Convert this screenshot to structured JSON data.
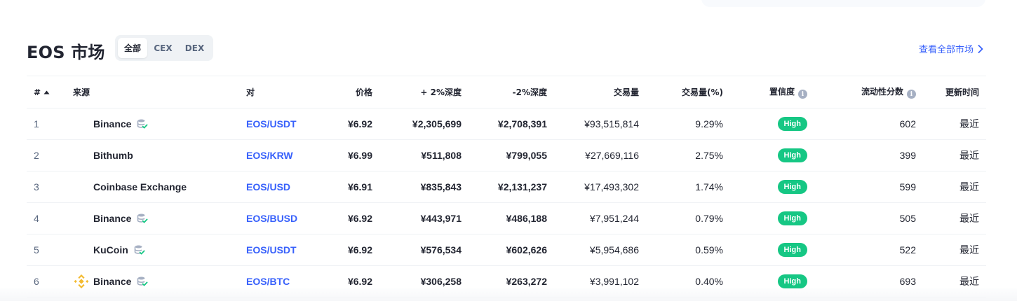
{
  "title": "EOS 市场",
  "filters": [
    "全部",
    "CEX",
    "DEX"
  ],
  "active_filter": "全部",
  "view_all": "查看全部市场",
  "columns": {
    "rank": "#",
    "source": "来源",
    "pair": "对",
    "price": "价格",
    "depth_plus": "+ 2%深度",
    "depth_minus": "-2%深度",
    "volume": "交易量",
    "volume_pct": "交易量(%)",
    "confidence": "置信度",
    "liquidity": "流动性分数",
    "updated": "更新时间"
  },
  "rows": [
    {
      "rank": "1",
      "source": "Binance",
      "verified_icon": true,
      "logo": "",
      "pair": "EOS/USDT",
      "price": "¥6.92",
      "depth_plus": "¥2,305,699",
      "depth_minus": "¥2,708,391",
      "volume": "¥93,515,814",
      "volume_pct": "9.29%",
      "confidence": "High",
      "liquidity": "602",
      "updated": "最近"
    },
    {
      "rank": "2",
      "source": "Bithumb",
      "verified_icon": false,
      "logo": "",
      "pair": "EOS/KRW",
      "price": "¥6.99",
      "depth_plus": "¥511,808",
      "depth_minus": "¥799,055",
      "volume": "¥27,669,116",
      "volume_pct": "2.75%",
      "confidence": "High",
      "liquidity": "399",
      "updated": "最近"
    },
    {
      "rank": "3",
      "source": "Coinbase Exchange",
      "verified_icon": false,
      "logo": "",
      "pair": "EOS/USD",
      "price": "¥6.91",
      "depth_plus": "¥835,843",
      "depth_minus": "¥2,131,237",
      "volume": "¥17,493,302",
      "volume_pct": "1.74%",
      "confidence": "High",
      "liquidity": "599",
      "updated": "最近"
    },
    {
      "rank": "4",
      "source": "Binance",
      "verified_icon": true,
      "logo": "",
      "pair": "EOS/BUSD",
      "price": "¥6.92",
      "depth_plus": "¥443,971",
      "depth_minus": "¥486,188",
      "volume": "¥7,951,244",
      "volume_pct": "0.79%",
      "confidence": "High",
      "liquidity": "505",
      "updated": "最近"
    },
    {
      "rank": "5",
      "source": "KuCoin",
      "verified_icon": true,
      "logo": "",
      "pair": "EOS/USDT",
      "price": "¥6.92",
      "depth_plus": "¥576,534",
      "depth_minus": "¥602,626",
      "volume": "¥5,954,686",
      "volume_pct": "0.59%",
      "confidence": "High",
      "liquidity": "522",
      "updated": "最近"
    },
    {
      "rank": "6",
      "source": "Binance",
      "verified_icon": true,
      "logo": "binance-logo-icon",
      "pair": "EOS/BTC",
      "price": "¥6.92",
      "depth_plus": "¥306,258",
      "depth_minus": "¥263,272",
      "volume": "¥3,991,102",
      "volume_pct": "0.40%",
      "confidence": "High",
      "liquidity": "693",
      "updated": "最近"
    }
  ],
  "colors": {
    "accent": "#3861fb",
    "high_badge": "#16c784",
    "muted": "#58667e",
    "binance_logo": "#f3ba2f"
  }
}
